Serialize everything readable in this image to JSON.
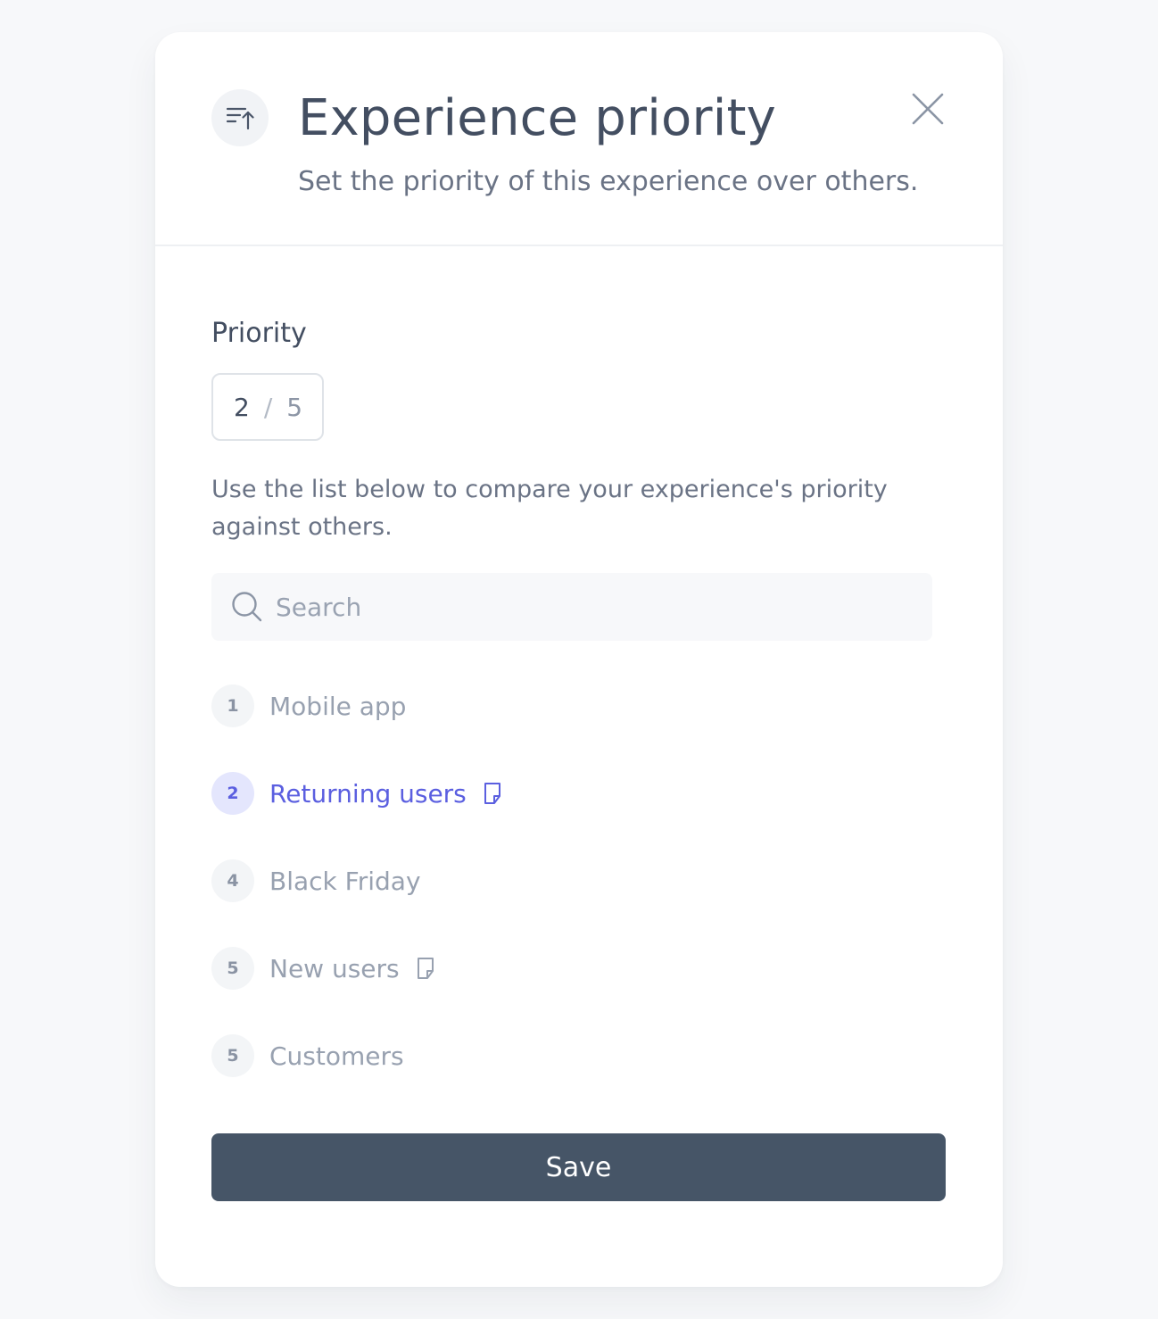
{
  "header": {
    "icon": "sort-priority-up-icon",
    "title": "Experience priority",
    "subtitle": "Set the priority of this experience over others.",
    "close_icon": "close-icon"
  },
  "priority": {
    "label": "Priority",
    "current": "2",
    "separator": "/",
    "total": "5"
  },
  "helper_text": "Use the list below to compare your experience's priority against others.",
  "search": {
    "icon": "search-icon",
    "placeholder": "Search",
    "value": ""
  },
  "experiences": [
    {
      "rank": "1",
      "name": "Mobile app",
      "has_note": false,
      "active": false
    },
    {
      "rank": "2",
      "name": "Returning users",
      "has_note": true,
      "active": true
    },
    {
      "rank": "4",
      "name": "Black Friday",
      "has_note": false,
      "active": false
    },
    {
      "rank": "5",
      "name": "New users",
      "has_note": true,
      "active": false
    },
    {
      "rank": "5",
      "name": "Customers",
      "has_note": false,
      "active": false
    }
  ],
  "actions": {
    "save_label": "Save"
  },
  "colors": {
    "accent": "#5b5fe0",
    "accent_bg": "#e4e6fd",
    "primary_button": "#465567",
    "title": "#434e61",
    "muted": "#98a1b0"
  }
}
